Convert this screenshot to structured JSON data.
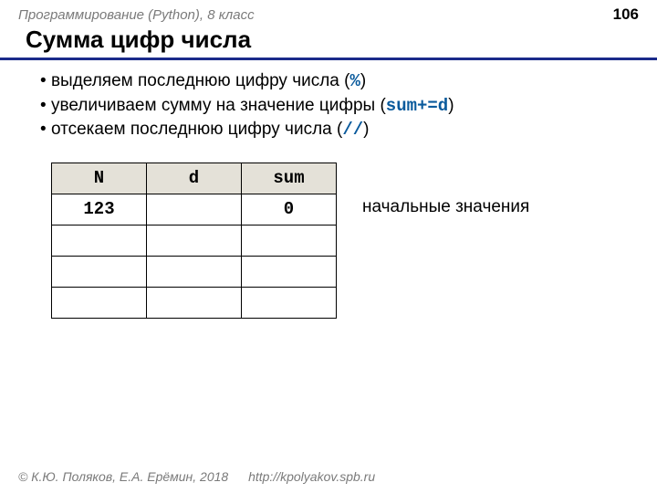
{
  "header": {
    "course": "Программирование (Python), 8 класс",
    "page": "106"
  },
  "title": "Сумма цифр числа",
  "bullets": [
    {
      "text": "выделяем последнюю цифру числа (",
      "code": "%",
      "tail": ")"
    },
    {
      "text": "увеличиваем сумму на значение цифры (",
      "code": "sum+=d",
      "tail": ")"
    },
    {
      "text": "отсекаем последнюю цифру числа (",
      "code": "//",
      "tail": ")"
    }
  ],
  "table": {
    "headers": [
      "N",
      "d",
      "sum"
    ],
    "rows": [
      [
        "123",
        "",
        "0"
      ],
      [
        "",
        "",
        ""
      ],
      [
        "",
        "",
        ""
      ],
      [
        "",
        "",
        ""
      ]
    ],
    "caption": "начальные значения"
  },
  "footer": {
    "copyright": "© К.Ю. Поляков, Е.А. Ерёмин, 2018",
    "url": "http://kpolyakov.spb.ru"
  }
}
